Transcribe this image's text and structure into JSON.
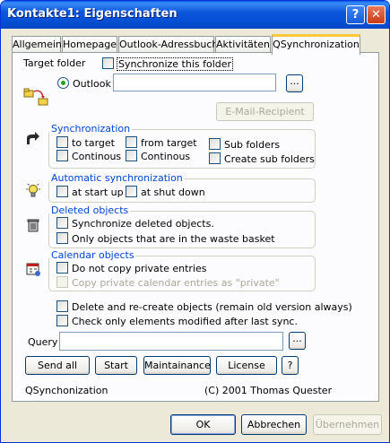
{
  "window": {
    "title": "Kontakte1: Eigenschaften",
    "help_glyph": "?",
    "close_glyph": "✕"
  },
  "tabs": [
    {
      "label": "Allgemein"
    },
    {
      "label": "Homepage"
    },
    {
      "label": "Outlook-Adressbuch"
    },
    {
      "label": "Aktivitäten"
    },
    {
      "label": "QSynchronization",
      "active": true
    }
  ],
  "target": {
    "label": "Target folder",
    "sync_folder_label": "Synchronize this folder",
    "outlook_label": "Outlook",
    "outlook_value": "",
    "browse_label": "...",
    "email_recipient_label": "E-Mail-Recipient"
  },
  "sync_group": {
    "title": "Synchronization",
    "to_target": "to target",
    "from_target": "from target",
    "continous_left": "Continous",
    "continous_right": "Continous",
    "sub_folders": "Sub folders",
    "create_sub_folders": "Create sub folders"
  },
  "auto_group": {
    "title": "Automatic synchronization",
    "at_start_up": "at start up",
    "at_shut_down": "at shut down"
  },
  "deleted_group": {
    "title": "Deleted objects",
    "sync_deleted": "Synchronize deleted objects.",
    "only_waste": "Only objects that are in the waste basket"
  },
  "calendar_group": {
    "title": "Calendar objects",
    "no_private": "Do not copy private entries",
    "copy_private_as": "Copy private calendar entries as \"private\""
  },
  "options": {
    "delete_recreate": "Delete and re-create objects (remain old version always)",
    "check_modified": "Check only elements modified after last sync."
  },
  "query": {
    "label": "Query",
    "value": "",
    "browse_label": "..."
  },
  "actions": {
    "send_all": "Send all",
    "start": "Start",
    "maintainance": "Maintainance",
    "license": "License",
    "help": "?"
  },
  "footer": {
    "product": "QSynchonization",
    "copyright": "(C) 2001 Thomas Quester"
  },
  "dialog_buttons": {
    "ok": "OK",
    "cancel": "Abbrechen",
    "apply": "Übernehmen"
  },
  "colors": {
    "title_bar": "#0551D6",
    "group_title": "#0046D5",
    "tab_highlight": "#FFC83C",
    "face": "#ECE9D8"
  }
}
